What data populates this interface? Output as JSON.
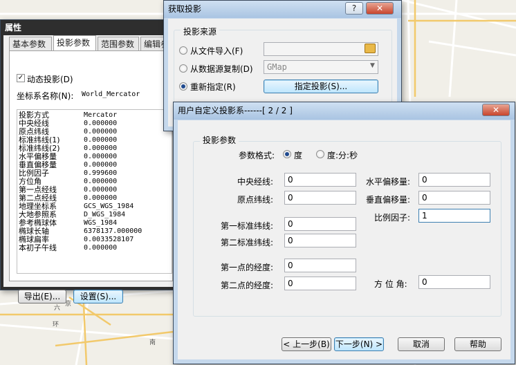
{
  "map_labels": [
    "六",
    "京",
    "环",
    "南"
  ],
  "win_props": {
    "title": "属性",
    "tabs": [
      "基本参数",
      "投影参数",
      "范围参数",
      "编辑参"
    ],
    "dynamic_label": "动态投影(D)",
    "crs_label": "坐标系名称(N):",
    "crs_value": "World_Mercator",
    "params": [
      [
        "投影方式",
        "Mercator"
      ],
      [
        "中央经线",
        "0.000000"
      ],
      [
        "原点纬线",
        "0.000000"
      ],
      [
        "标准纬线(1)",
        "0.000000"
      ],
      [
        "标准纬线(2)",
        "0.000000"
      ],
      [
        "水平偏移量",
        "0.000000"
      ],
      [
        "垂直偏移量",
        "0.000000"
      ],
      [
        "比例因子",
        "0.999600"
      ],
      [
        "方位角",
        "0.000000"
      ],
      [
        "第一点经线",
        "0.000000"
      ],
      [
        "第二点经线",
        "0.000000"
      ],
      [
        "地理坐标系",
        "GCS_WGS_1984"
      ],
      [
        "大地参照系",
        "D_WGS_1984"
      ],
      [
        "参考椭球体",
        "WGS_1984"
      ],
      [
        "椭球长轴",
        "6378137.000000"
      ],
      [
        "椭球扁率",
        "0.0033528107"
      ],
      [
        "本初子午线",
        "0.000000"
      ]
    ],
    "export_btn": "导出(E)...",
    "settings_btn": "设置(S)..."
  },
  "win_get": {
    "title": "获取投影",
    "help_btn": "?",
    "close_btn": "✕",
    "group_label": "投影来源",
    "opt_file": "从文件导入(F)",
    "opt_db": "从数据源复制(D)",
    "db_value": "GMap",
    "opt_new": "重新指定(R)",
    "specify_btn": "指定投影(S)..."
  },
  "win_custom": {
    "title": "用户自定义投影系------[ 2 / 2 ]",
    "close_btn": "✕",
    "group_label": "投影参数",
    "format_label": "参数格式:",
    "fmt_deg": "度",
    "fmt_dms": "度:分:秒",
    "central_lon_label": "中央经线:",
    "central_lon": "0",
    "false_east_label": "水平偏移量:",
    "false_east": "0",
    "origin_lat_label": "原点纬线:",
    "origin_lat": "0",
    "false_north_label": "垂直偏移量:",
    "false_north": "0",
    "scale_label": "比例因子:",
    "scale": "1",
    "std1_label": "第一标准纬线:",
    "std1": "0",
    "std2_label": "第二标准纬线:",
    "std2": "0",
    "pt1_label": "第一点的经度:",
    "pt1": "0",
    "pt2_label": "第二点的经度:",
    "pt2": "0",
    "azimuth_label": "方 位 角:",
    "azimuth": "0",
    "back_btn": "< 上一步(B)",
    "next_btn": "下一步(N) >",
    "cancel_btn": "取消",
    "help_btn": "帮助"
  }
}
